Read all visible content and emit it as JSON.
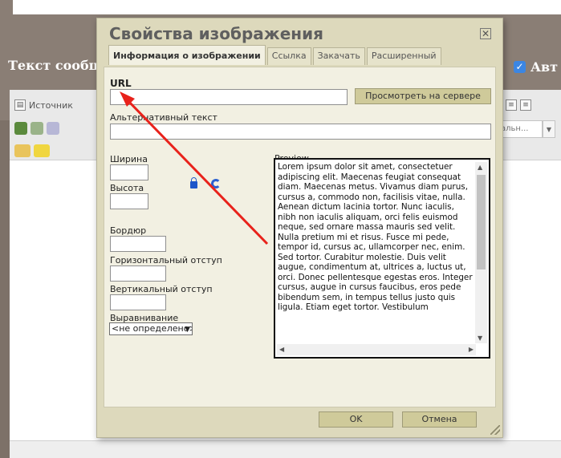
{
  "background": {
    "section_title": "Текст сообщения",
    "auto_label": "Авт",
    "toolbar": {
      "source_label": "Источник",
      "style_select_value": "альн..."
    }
  },
  "dialog": {
    "title": "Свойства изображения",
    "tabs": [
      {
        "label": "Информация о изображении"
      },
      {
        "label": "Ссылка"
      },
      {
        "label": "Закачать"
      },
      {
        "label": "Расширенный"
      }
    ],
    "url": {
      "label": "URL",
      "value": ""
    },
    "browse_server_label": "Просмотреть на сервере",
    "alt_text": {
      "label": "Альтернативный текст",
      "value": ""
    },
    "width": {
      "label": "Ширина",
      "value": ""
    },
    "height": {
      "label": "Высота",
      "value": ""
    },
    "border": {
      "label": "Бордюр",
      "value": ""
    },
    "hspace": {
      "label": "Горизонтальный отступ",
      "value": ""
    },
    "vspace": {
      "label": "Вертикальный отступ",
      "value": ""
    },
    "align": {
      "label": "Выравнивание",
      "selected": "<не определено>"
    },
    "preview": {
      "label": "Preview",
      "text": "Lorem ipsum dolor sit amet, consectetuer adipiscing elit. Maecenas feugiat consequat diam. Maecenas metus. Vivamus diam purus, cursus a, commodo non, facilisis vitae, nulla. Aenean dictum lacinia tortor. Nunc iaculis, nibh non iaculis aliquam, orci felis euismod neque, sed ornare massa mauris sed velit. Nulla pretium mi et risus. Fusce mi pede, tempor id, cursus ac, ullamcorper nec, enim. Sed tortor. Curabitur molestie. Duis velit augue, condimentum at, ultrices a, luctus ut, orci. Donec pellentesque egestas eros. Integer cursus, augue in cursus faucibus, eros pede bibendum sem, in tempus tellus justo quis ligula. Etiam eget tortor. Vestibulum"
    },
    "ok_label": "OK",
    "cancel_label": "Отмена"
  },
  "annotation_color": "#e8221b"
}
